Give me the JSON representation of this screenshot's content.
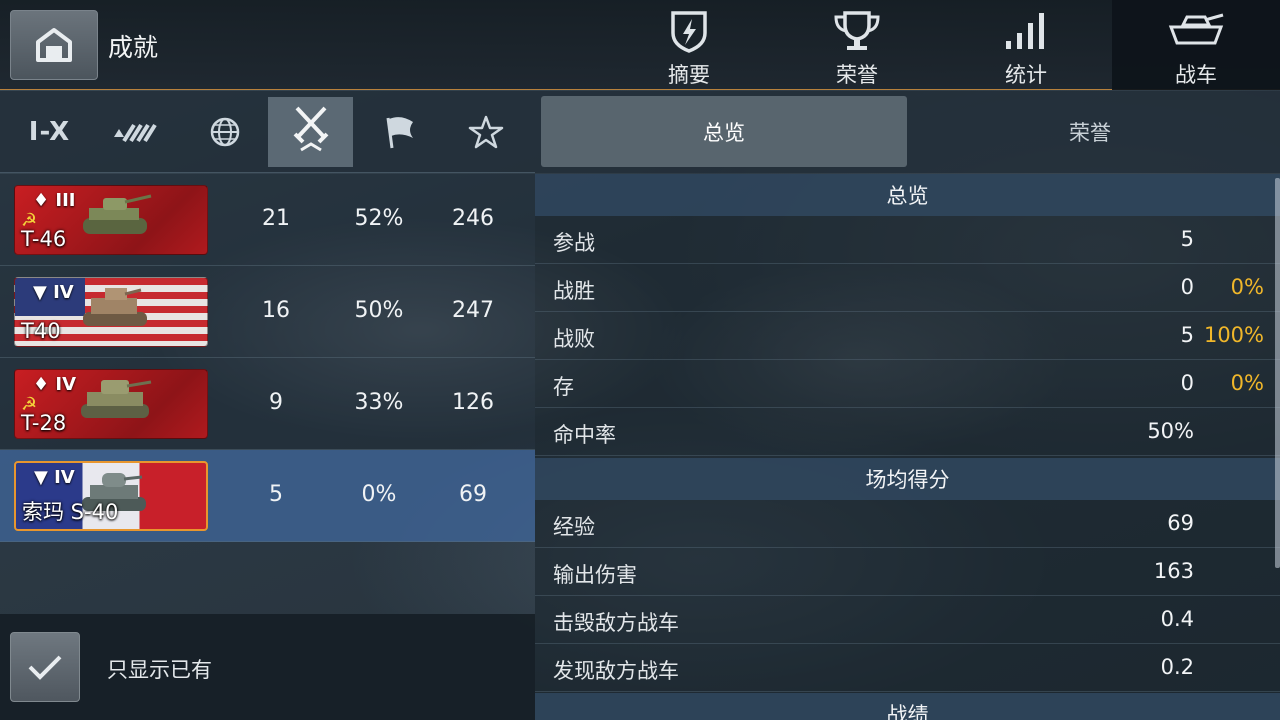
{
  "header": {
    "title": "成就",
    "tabs": [
      {
        "label": "摘要",
        "icon": "shield-lightning-icon"
      },
      {
        "label": "荣誉",
        "icon": "trophy-icon"
      },
      {
        "label": "统计",
        "icon": "bar-chart-icon"
      },
      {
        "label": "战车",
        "icon": "tank-icon"
      }
    ],
    "active_tab": "战车",
    "accent_color": "#b8813c"
  },
  "filters": {
    "tier_label": "I-X",
    "icons": [
      "tier-filter-icon",
      "vehicle-type-filter-icon",
      "nation-filter-icon",
      "crossed-swords-filter-icon",
      "flag-filter-icon",
      "star-filter-icon"
    ],
    "active": "crossed-swords-filter-icon"
  },
  "tanks": [
    {
      "tier": "III",
      "name": "T-46",
      "nation": "ussr",
      "battles": "21",
      "win_rate": "52%",
      "avg_xp": "246"
    },
    {
      "tier": "IV",
      "name": "T40",
      "nation": "usa",
      "battles": "16",
      "win_rate": "50%",
      "avg_xp": "247"
    },
    {
      "tier": "IV",
      "name": "T-28",
      "nation": "ussr",
      "battles": "9",
      "win_rate": "33%",
      "avg_xp": "126"
    },
    {
      "tier": "IV",
      "name": "索玛 S-40",
      "nation": "france",
      "battles": "5",
      "win_rate": "0%",
      "avg_xp": "69"
    }
  ],
  "show_owned": {
    "label": "只显示已有",
    "checked": true
  },
  "right_tabs": [
    {
      "label": "总览"
    },
    {
      "label": "荣誉"
    }
  ],
  "overview": {
    "header": "总览",
    "rows": [
      {
        "label": "参战",
        "value": "5",
        "pct": ""
      },
      {
        "label": "战胜",
        "value": "0",
        "pct": "0%"
      },
      {
        "label": "战败",
        "value": "5",
        "pct": "100%"
      },
      {
        "label": "存",
        "value": "0",
        "pct": "0%"
      },
      {
        "label": "命中率",
        "value": "50%",
        "pct": ""
      }
    ]
  },
  "avg_score": {
    "header": "场均得分",
    "rows": [
      {
        "label": "经验",
        "value": "69"
      },
      {
        "label": "输出伤害",
        "value": "163"
      },
      {
        "label": "击毁敌方战车",
        "value": "0.4"
      },
      {
        "label": "发现敌方战车",
        "value": "0.2"
      }
    ]
  },
  "record_header": "战绩"
}
